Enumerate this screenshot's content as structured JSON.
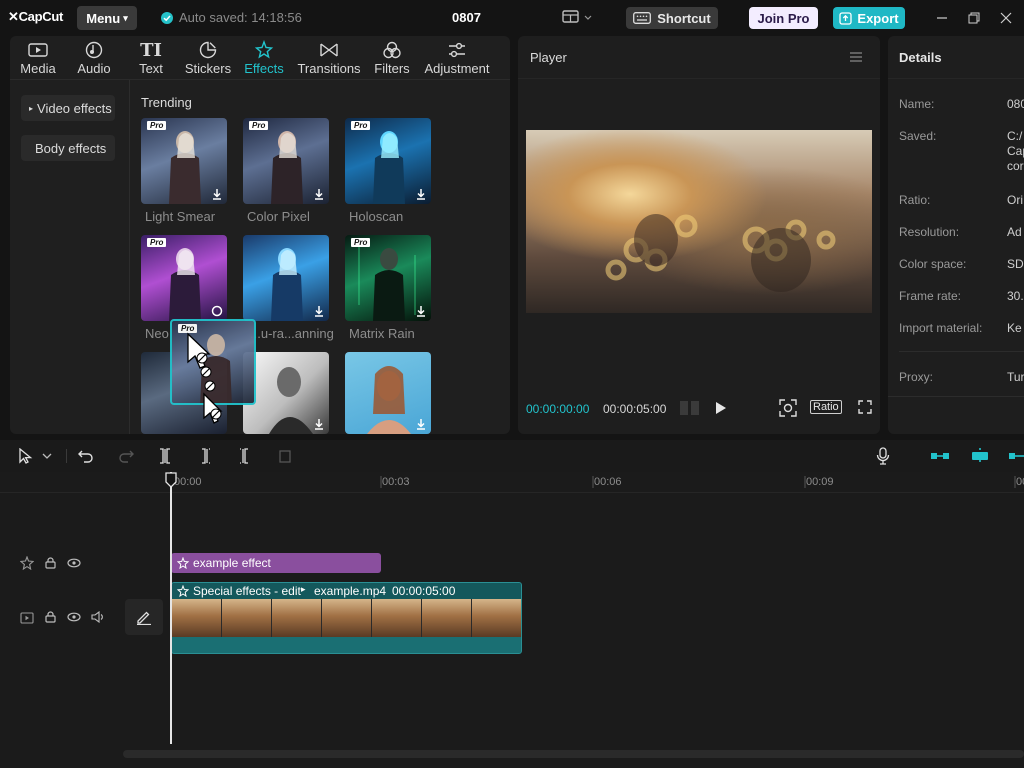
{
  "app": {
    "logo": "CapCut",
    "menu_label": "Menu",
    "autosave": "Auto saved: 14:18:56",
    "project_name": "0807",
    "shortcut_label": "Shortcut",
    "join_pro_label": "Join Pro",
    "export_label": "Export"
  },
  "tabs": [
    {
      "label": "Media",
      "icon": "media-icon"
    },
    {
      "label": "Audio",
      "icon": "audio-icon"
    },
    {
      "label": "Text",
      "icon": "text-icon"
    },
    {
      "label": "Stickers",
      "icon": "stickers-icon"
    },
    {
      "label": "Effects",
      "icon": "effects-icon",
      "active": true
    },
    {
      "label": "Transitions",
      "icon": "transitions-icon"
    },
    {
      "label": "Filters",
      "icon": "filters-icon"
    },
    {
      "label": "Adjustment",
      "icon": "adjustment-icon"
    }
  ],
  "sidebar": {
    "video_effects": "Video effects",
    "body_effects": "Body effects"
  },
  "effects": {
    "section_title": "Trending",
    "pro_badge": "Pro",
    "items": [
      {
        "name": "Light Smear",
        "pro": true
      },
      {
        "name": "Color Pixel",
        "pro": true
      },
      {
        "name": "Holoscan",
        "pro": true
      },
      {
        "name": "Neo",
        "pro": true
      },
      {
        "name": "...u-ra...anning",
        "pro": false
      },
      {
        "name": "Matrix Rain",
        "pro": true
      }
    ]
  },
  "player": {
    "title": "Player",
    "current_time": "00:00:00:00",
    "duration": "00:00:05:00",
    "ratio_label": "Ratio"
  },
  "details": {
    "title": "Details",
    "rows": [
      {
        "label": "Name:",
        "value": "080"
      },
      {
        "label": "Saved:",
        "value": "C:/ Cap cor"
      },
      {
        "label": "Ratio:",
        "value": "Ori"
      },
      {
        "label": "Resolution:",
        "value": "Ad"
      },
      {
        "label": "Color space:",
        "value": "SD"
      },
      {
        "label": "Frame rate:",
        "value": "30."
      },
      {
        "label": "Import material:",
        "value": "Ke"
      },
      {
        "label": "Proxy:",
        "value": "Tur"
      }
    ]
  },
  "timeline": {
    "ruler": [
      "00:00",
      "00:03",
      "00:06",
      "00:09",
      "00"
    ],
    "effect_clip": "example effect",
    "video_clip_effect": "Special effects - edit",
    "video_clip_name": "example.mp4",
    "video_clip_duration": "00:00:05:00"
  },
  "colors": {
    "accent": "#22c3cc",
    "effect_clip": "#8a4f9e",
    "video_clip": "#1a6f73"
  }
}
